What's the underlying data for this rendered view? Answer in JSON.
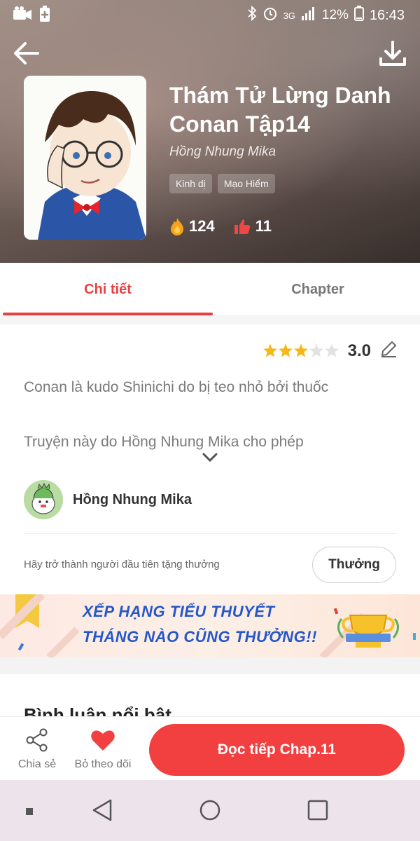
{
  "status_bar": {
    "network": "3G",
    "battery": "12%",
    "time": "16:43"
  },
  "book": {
    "title": "Thám Tử Lừng Danh Conan Tập14",
    "author": "Hồng Nhung Mika",
    "tags": [
      "Kinh dị",
      "Mạo Hiểm"
    ],
    "views": "124",
    "likes": "11"
  },
  "tabs": {
    "detail": "Chi tiết",
    "chapter": "Chapter"
  },
  "rating": {
    "value": "3.0",
    "stars_filled": 3,
    "stars_total": 5,
    "star_color": "#f5b818"
  },
  "description": {
    "line1": "Conan là kudo Shinichi do bị teo nhỏ bởi thuốc",
    "line2": "Truyện này do Hồng Nhung Mika cho phép"
  },
  "uploader": {
    "name": "Hồng Nhung Mika"
  },
  "reward": {
    "text": "Hãy trở thành người đầu tiên tặng thưởng",
    "button": "Thưởng"
  },
  "banner": {
    "line1": "XẾP HẠNG TIỂU THUYẾT",
    "line2": "THÁNG NÀO CŨNG THƯỞNG!!"
  },
  "section": {
    "heading": "Bình luận nổi bật"
  },
  "actions": {
    "share": "Chia sẻ",
    "unfollow": "Bỏ theo dõi",
    "read": "Đọc tiếp Chap.11"
  },
  "colors": {
    "accent": "#e84040",
    "button": "#f23f40"
  }
}
